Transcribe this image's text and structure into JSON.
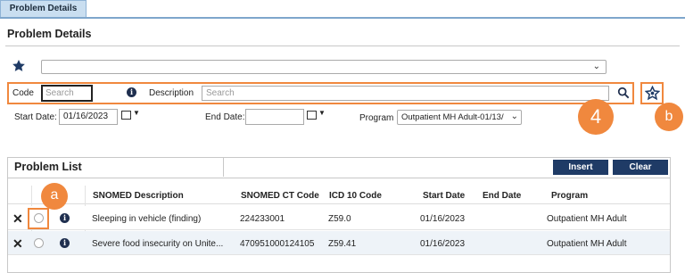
{
  "tab": {
    "label": "Problem Details"
  },
  "page_title": "Problem Details",
  "search": {
    "code_label": "Code",
    "code_placeholder": "Search",
    "description_label": "Description",
    "description_placeholder": "Search"
  },
  "filters": {
    "start_date_label": "Start Date:",
    "start_date_value": "01/16/2023",
    "end_date_label": "End Date:",
    "end_date_value": "",
    "program_label": "Program",
    "program_value": "Outpatient MH Adult-01/13/"
  },
  "callouts": {
    "four": "4",
    "a": "a",
    "b": "b"
  },
  "problem_list": {
    "title": "Problem List",
    "insert_label": "Insert",
    "clear_label": "Clear",
    "columns": [
      "SNOMED Description",
      "SNOMED CT Code",
      "ICD 10 Code",
      "Start Date",
      "End Date",
      "Program"
    ],
    "rows": [
      {
        "snomed_description": "Sleeping in vehicle (finding)",
        "snomed_ct_code": "224233001",
        "icd10": "Z59.0",
        "start_date": "01/16/2023",
        "end_date": "",
        "program": "Outpatient MH Adult"
      },
      {
        "snomed_description": "Severe food insecurity on Unite...",
        "snomed_ct_code": "470951000124105",
        "icd10": "Z59.41",
        "start_date": "01/16/2023",
        "end_date": "",
        "program": "Outpatient MH Adult"
      }
    ]
  },
  "colors": {
    "accent": "#f0883e",
    "navy": "#1f3b66",
    "tab_bg": "#c9def0"
  },
  "icons": [
    "star-icon",
    "info-icon",
    "search-icon",
    "star-outline-icon",
    "calendar-icon",
    "delete-icon",
    "chevron-down-icon"
  ]
}
